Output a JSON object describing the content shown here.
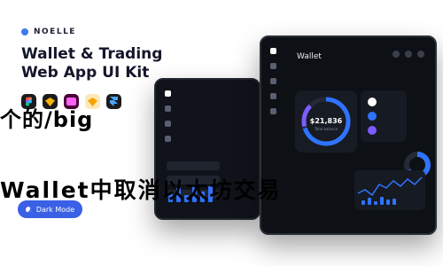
{
  "brand": {
    "name": "NOELLE"
  },
  "headline": {
    "line1": "Wallet & Trading",
    "line2": "Web App UI Kit"
  },
  "tool_icons": [
    "figma-icon",
    "sketch-icon",
    "xd-icon",
    "sketch-diamond-icon",
    "framer-icon"
  ],
  "overlay": {
    "line1": "个的/big",
    "line2": "Wallet中取消以太坊交易"
  },
  "dark_mode": {
    "label": "Dark Mode"
  },
  "app": {
    "title": "Wallet",
    "balance": "$21,836",
    "balance_sub": "Total balance"
  },
  "colors": {
    "accent": "#3c7bf2",
    "dark_pill": "#3a60e6",
    "device_bg": "#0d1015",
    "chart_line": "#2f73ff"
  }
}
